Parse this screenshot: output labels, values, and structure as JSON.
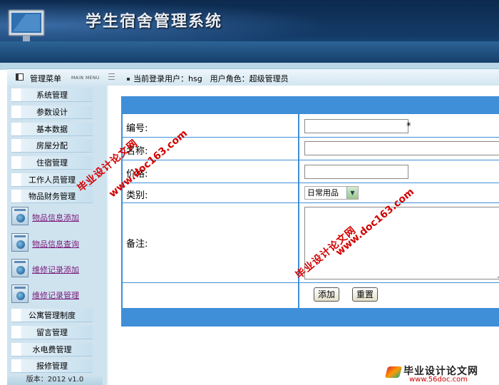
{
  "header": {
    "title": "学生宿舍管理系统"
  },
  "infobar": {
    "menu_title": "管理菜单",
    "menu_subtitle": "MAIN MENU",
    "user_info": "当前登录用户：hsg　用户角色：超级管理员"
  },
  "sidebar": {
    "items_top": [
      "系统管理",
      "参数设计",
      "基本数据",
      "房屋分配",
      "住宿管理",
      "工作人员管理",
      "物品财务管理"
    ],
    "sub_items": [
      "物品信息添加",
      "物品信息查询",
      "维修记录添加",
      "维修记录管理"
    ],
    "items_bottom": [
      "公寓管理制度",
      "留言管理",
      "水电费管理",
      "报修管理"
    ],
    "version": "版本：2012 v1.0"
  },
  "form": {
    "fields": {
      "number_label": "编号:",
      "name_label": "名称:",
      "price_label": "价格:",
      "category_label": "类别:",
      "remark_label": "备注:"
    },
    "required_mark": "*",
    "category_value": "日常用品",
    "add_button": "添加",
    "reset_button": "重置"
  },
  "watermarks": {
    "site_cn": "毕业设计论文网",
    "site_url": "www.doc163.com",
    "logo_title": "毕业设计论文网",
    "logo_url": "www.56doc.com"
  },
  "colors": {
    "header": "#133a66",
    "form_border": "#3f8fd8",
    "sidebar": "#cfe3ef"
  }
}
